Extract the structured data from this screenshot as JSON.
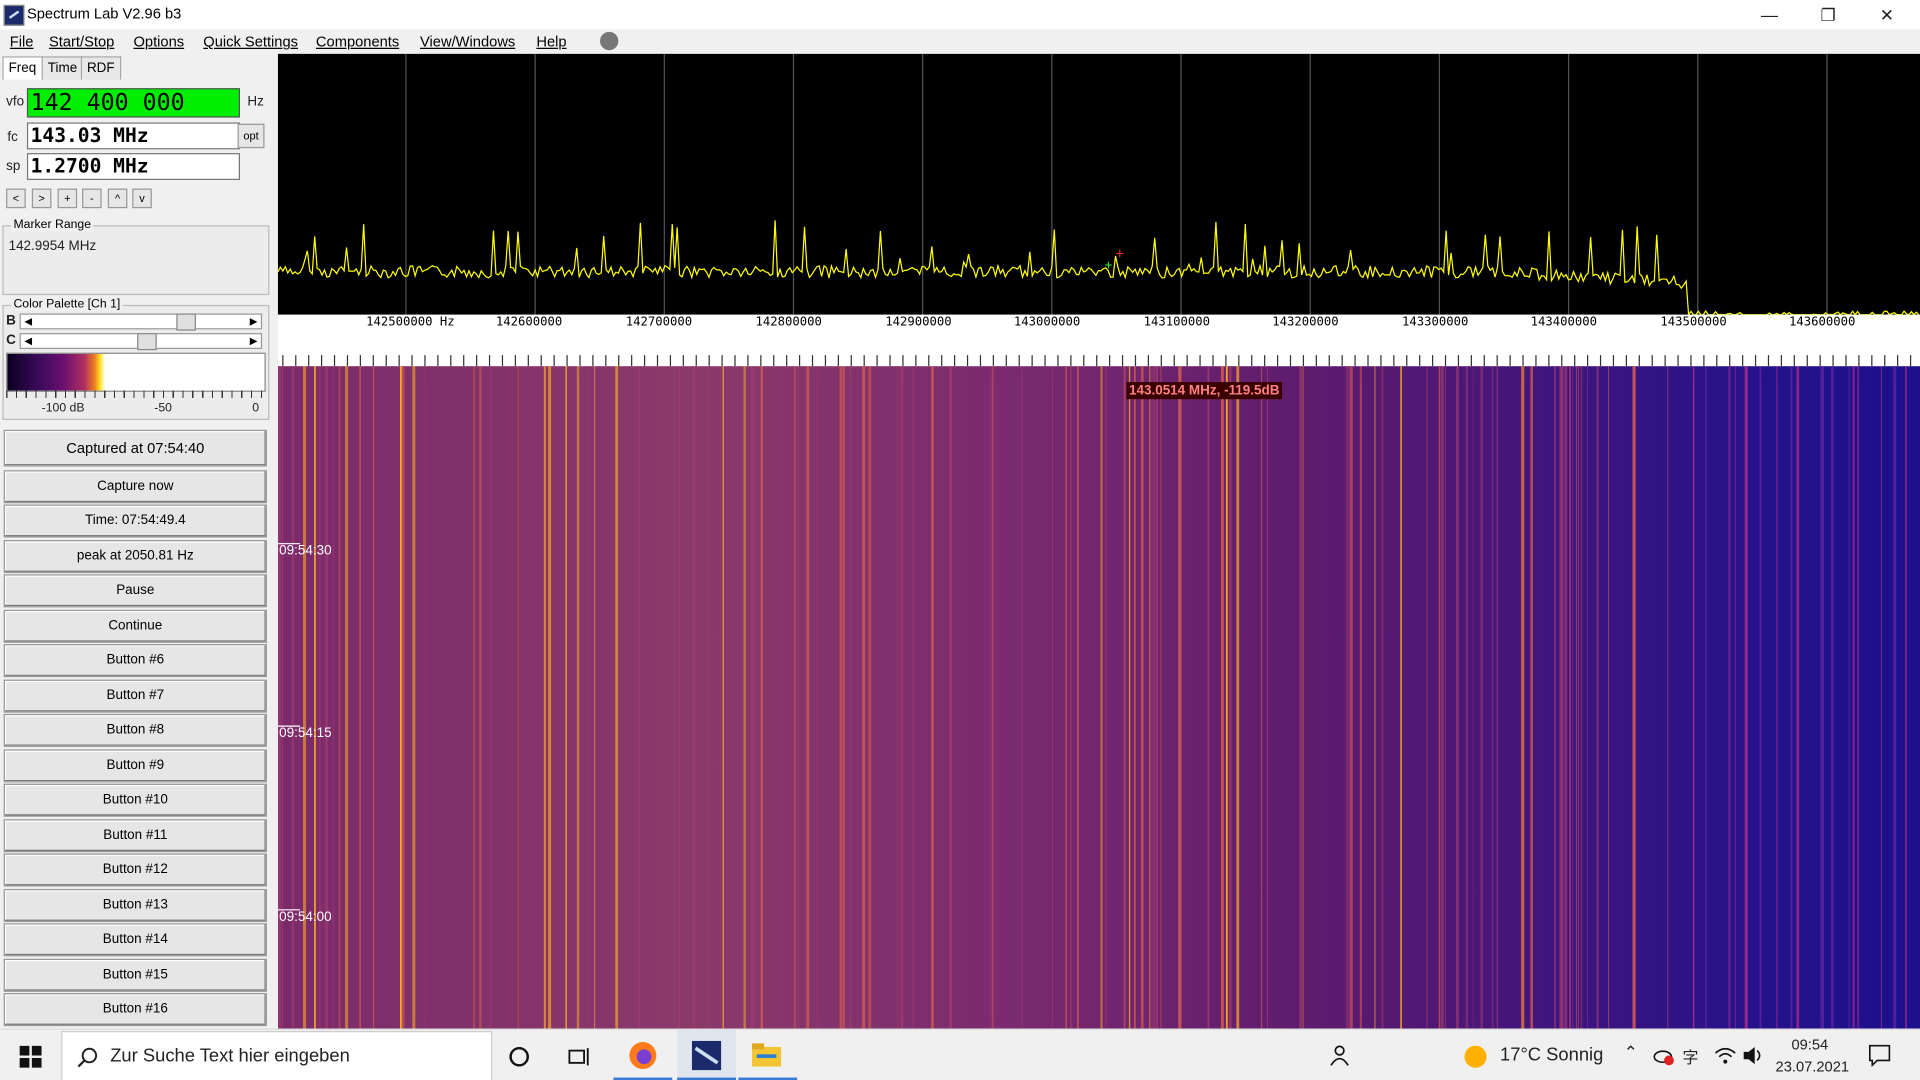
{
  "window": {
    "title": "Spectrum Lab V2.96 b3"
  },
  "menu": [
    "File",
    "Start/Stop",
    "Options",
    "Quick Settings",
    "Components",
    "View/Windows",
    "Help"
  ],
  "tabs": [
    "Freq",
    "Time",
    "RDF"
  ],
  "freq": {
    "vfo_label": "vfo",
    "vfo_value": "142 400 000",
    "vfo_unit": "Hz",
    "fc_label": "fc",
    "fc_value": "143.03 MHz",
    "sp_label": "sp",
    "sp_value": "1.2700 MHz",
    "opt_label": "opt",
    "nav": [
      "<",
      ">",
      "+",
      "-",
      "^",
      "v"
    ]
  },
  "marker_range": {
    "title": "Marker Range",
    "value": "142.9954 MHz"
  },
  "palette": {
    "title": "Color Palette [Ch 1]",
    "b_label": "B",
    "c_label": "C",
    "b_level": 0.72,
    "c_level": 0.52,
    "scale": [
      "-100 dB",
      "-50",
      "0"
    ]
  },
  "buttons": [
    "Captured at 07:54:40",
    "Capture now",
    "Time:  07:54:49.4",
    "peak at 2050.81 Hz",
    "Pause",
    "Continue",
    "Button #6",
    "Button #7",
    "Button #8",
    "Button #9",
    "Button #10",
    "Button #11",
    "Button #12",
    "Button #13",
    "Button #14",
    "Button #15",
    "Button #16"
  ],
  "axis": {
    "labels": [
      "142500000 Hz",
      "142600000",
      "142700000",
      "142800000",
      "142900000",
      "143000000",
      "143100000",
      "143200000",
      "143300000",
      "143400000",
      "143500000",
      "143600000"
    ]
  },
  "waterfall": {
    "times": [
      "09:54:30",
      "09:54:15",
      "09:54:00"
    ],
    "marker": "143.0514 MHz, -119.5dB"
  },
  "taskbar": {
    "search_placeholder": "Zur Suche Text hier eingeben",
    "weather": "17°C  Sonnig",
    "time": "09:54",
    "date": "23.07.2021"
  },
  "colors": {
    "vfo_bg": "#00ee00",
    "trace": "#ffff00",
    "waterfall_hot": "#ffb020"
  }
}
